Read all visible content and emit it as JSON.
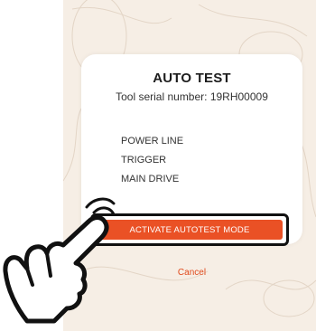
{
  "dialog": {
    "title": "AUTO TEST",
    "subtitle": "Tool serial number: 19RH00009",
    "tests": [
      "POWER LINE",
      "TRIGGER",
      "MAIN DRIVE"
    ],
    "activate_label": "ACTIVATE AUTOTEST MODE",
    "cancel_label": "Cancel"
  },
  "colors": {
    "accent": "#ea5125",
    "background": "#f6eee5",
    "text": "#1c1c1c"
  },
  "icons": {
    "hand": "pointing-hand-icon"
  }
}
